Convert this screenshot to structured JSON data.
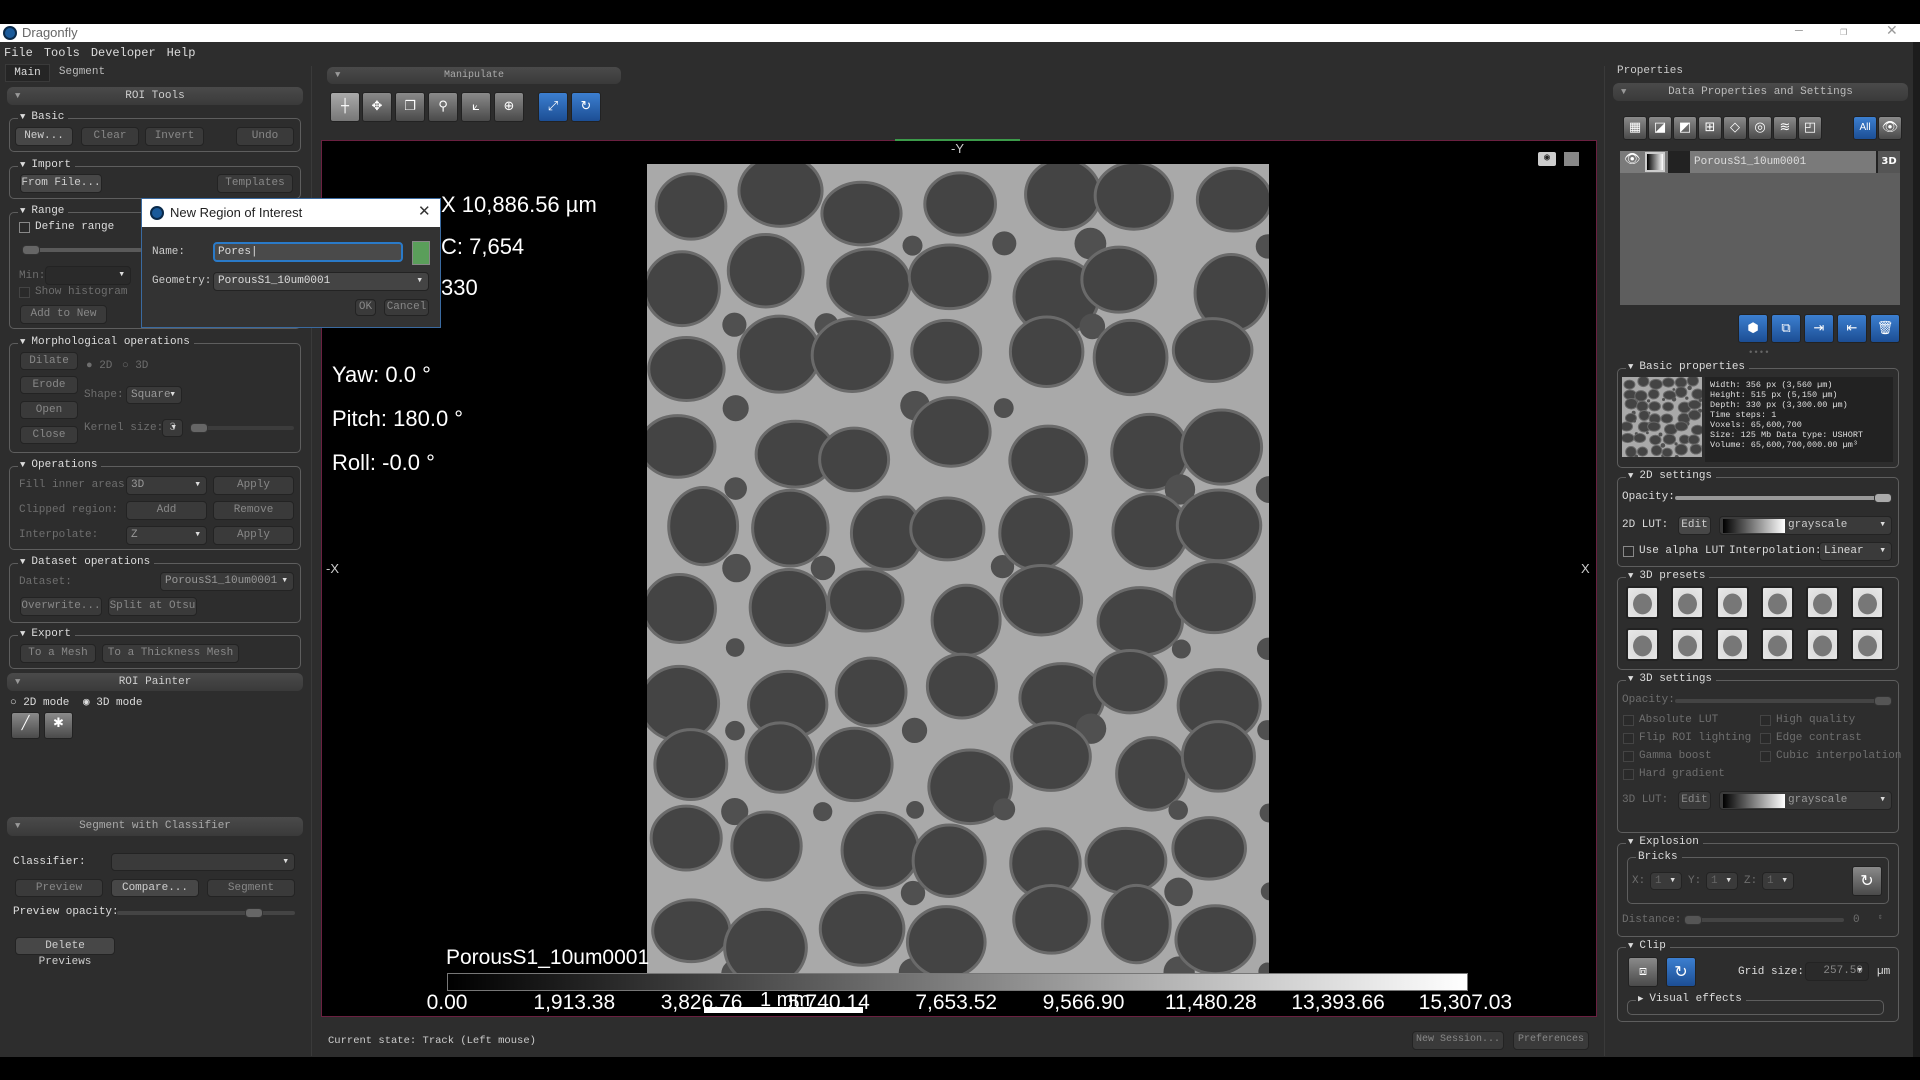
{
  "app": {
    "title": "Dragonfly",
    "menu": [
      "File",
      "Tools",
      "Developer",
      "Help"
    ],
    "tabs": [
      "Main",
      "Segment"
    ]
  },
  "left": {
    "roi_tools": "ROI Tools",
    "basic": {
      "label": "Basic",
      "buttons": [
        "New...",
        "Clear",
        "Invert",
        "Undo"
      ]
    },
    "import": {
      "label": "Import",
      "from_file": "From File...",
      "templates": "Templates"
    },
    "range": {
      "label": "Range",
      "define_range": "Define range",
      "min": "Min:",
      "show_histogram": "Show histogram",
      "add_to_new": "Add to New"
    },
    "morph": {
      "label": "Morphological operations",
      "buttons": [
        "Dilate",
        "Erode",
        "Open",
        "Close"
      ],
      "radio_2d": "2D",
      "radio_3d": "3D",
      "shape_label": "Shape:",
      "shape_value": "Square",
      "kernel_label": "Kernel size:",
      "kernel_value": "3"
    },
    "operations": {
      "label": "Operations",
      "rows": [
        {
          "label": "Fill inner areas:",
          "control": "3D",
          "button": "Apply"
        },
        {
          "label": "Clipped region:",
          "control": "Add",
          "button": "Remove"
        },
        {
          "label": "Interpolate:",
          "control": "Z",
          "button": "Apply"
        }
      ]
    },
    "dataset_ops": {
      "label": "Dataset operations",
      "dataset_label": "Dataset:",
      "dataset_value": "PorousS1_10um0001",
      "overwrite": "Overwrite...",
      "split": "Split at Otsu"
    },
    "export": {
      "label": "Export",
      "to_mesh": "To a Mesh",
      "to_thickness": "To a Thickness Mesh"
    },
    "roi_painter": {
      "label": "ROI Painter",
      "mode_2d": "2D mode",
      "mode_3d": "3D mode",
      "selected_mode": "3D mode"
    },
    "classifier": {
      "label": "Segment with Classifier",
      "classifier_label": "Classifier:",
      "classifier_value": "",
      "preview": "Preview",
      "compare": "Compare...",
      "segment": "Segment",
      "opacity_label": "Preview opacity:",
      "opacity_value": 0.8,
      "delete_previews": "Delete Previews"
    }
  },
  "toolbar": {
    "manipulate": "Manipulate",
    "tools": [
      "crosshair-icon",
      "move-icon",
      "slices-icon",
      "zoom-icon",
      "axes-icon",
      "target-icon",
      "fit-view-icon",
      "reset-view-icon"
    ]
  },
  "viewport": {
    "axis_top": "-Y",
    "axis_left": "-X",
    "axis_right": "X",
    "info": [
      "X 10,886.56 µm",
      "C: 7,654",
      "330"
    ],
    "yaw": "Yaw: 0.0 °",
    "pitch": "Pitch: 180.0 °",
    "roll": "Roll: -0.0 °",
    "dataset_name": "PorousS1_10um0001",
    "colorbar_ticks": [
      "0.00",
      "1,913.38",
      "3,826.76",
      "5,740.14",
      "7,653.52",
      "9,566.90",
      "11,480.28",
      "13,393.66",
      "15,307.03"
    ],
    "scale_bar": "1 mm"
  },
  "dialog": {
    "title": "New Region of Interest",
    "name_label": "Name:",
    "name_value": "Pores",
    "geometry_label": "Geometry:",
    "geometry_value": "PorousS1_10um0001",
    "ok": "OK",
    "cancel": "Cancel",
    "color": "#5a9e5a"
  },
  "status": {
    "text": "Current state: Track (Left mouse)",
    "new_session": "New Session...",
    "preferences": "Preferences"
  },
  "right": {
    "title": "Properties",
    "header": "Data Properties and Settings",
    "all": "All",
    "dataset": {
      "name": "PorousS1_10um0001",
      "badge": "3D"
    },
    "basic": {
      "label": "Basic properties",
      "lines": [
        "Width: 356 px (3,560 µm)",
        "Height: 515 px (5,150 µm)",
        "Depth: 330 px (3,300.00 µm)",
        "Time steps: 1",
        "Voxels: 65,600,700",
        "Size: 125 Mb  Data type: USHORT",
        "Volume: 65,600,700,000.00 µm³"
      ]
    },
    "s2d": {
      "label": "2D settings",
      "opacity": "Opacity:",
      "opacity_value": 1.0,
      "lut": "2D LUT:",
      "edit": "Edit",
      "lut_value": "grayscale",
      "alpha": "Use alpha LUT",
      "interp": "Interpolation:",
      "interp_value": "Linear"
    },
    "presets": {
      "label": "3D presets"
    },
    "s3d": {
      "label": "3D settings",
      "opacity": "Opacity:",
      "checks": [
        "Absolute LUT",
        "High quality",
        "Flip ROI lighting",
        "Edge contrast",
        "Gamma boost",
        "Cubic interpolation",
        "Hard gradient"
      ],
      "lut": "3D LUT:",
      "edit": "Edit",
      "lut_value": "grayscale"
    },
    "explosion": {
      "label": "Explosion",
      "bricks": "Bricks",
      "x": "X:",
      "y": "Y:",
      "z": "Z:",
      "xv": "1",
      "yv": "1",
      "zv": "1",
      "distance": "Distance:",
      "distance_value": "0"
    },
    "clip": {
      "label": "Clip",
      "grid_label": "Grid size:",
      "grid_value": "257.50",
      "unit": "µm",
      "visual_effects": "Visual effects"
    }
  }
}
